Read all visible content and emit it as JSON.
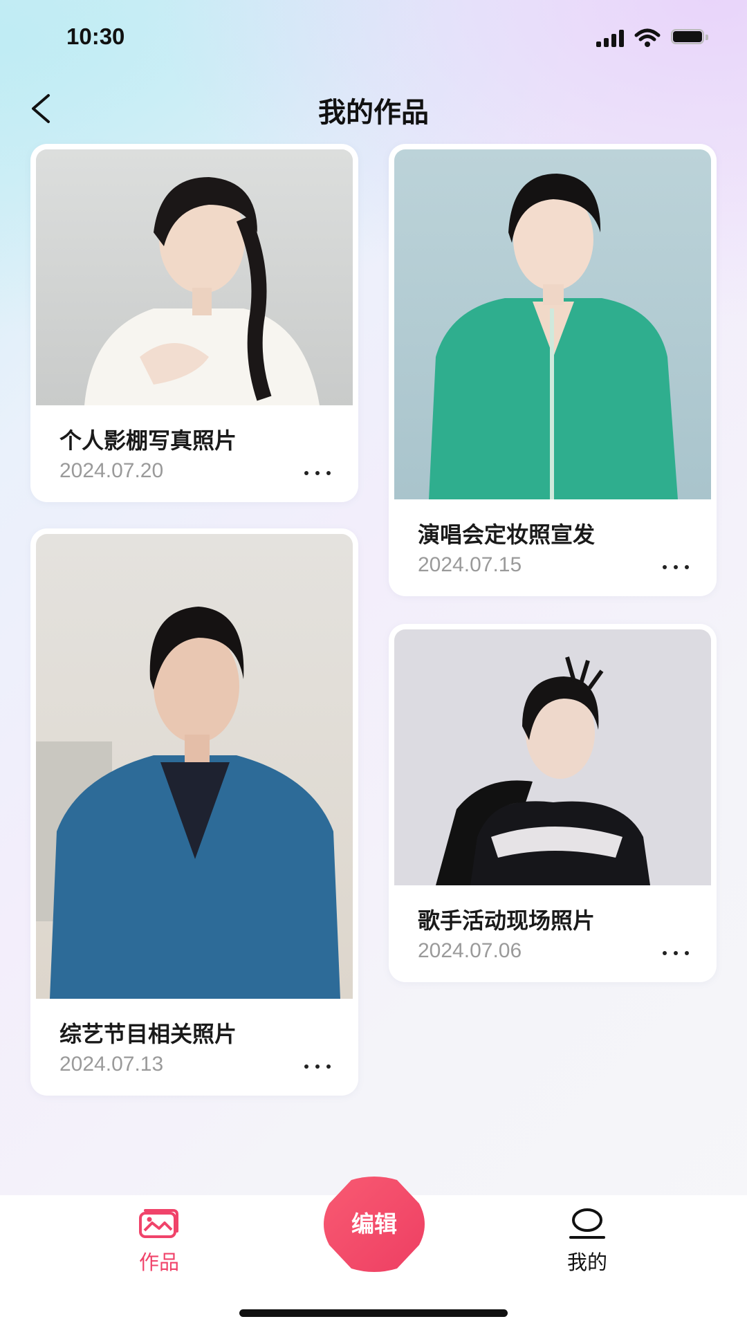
{
  "status_bar": {
    "time": "10:30"
  },
  "header": {
    "title": "我的作品"
  },
  "works": [
    {
      "title": "个人影棚写真照片",
      "date": "2024.07.20",
      "image": "woman-braid-white-top"
    },
    {
      "title": "演唱会定妆照宣发",
      "date": "2024.07.15",
      "image": "woman-green-tweed-jacket"
    },
    {
      "title": "综艺节目相关照片",
      "date": "2024.07.13",
      "image": "man-blue-suit"
    },
    {
      "title": "歌手活动现场照片",
      "date": "2024.07.06",
      "image": "woman-black-dress-gloves"
    }
  ],
  "tabbar": {
    "works_label": "作品",
    "edit_label": "编辑",
    "mine_label": "我的"
  },
  "colors": {
    "accent": "#f0436a",
    "text": "#111111",
    "date": "#9a9a9a"
  }
}
